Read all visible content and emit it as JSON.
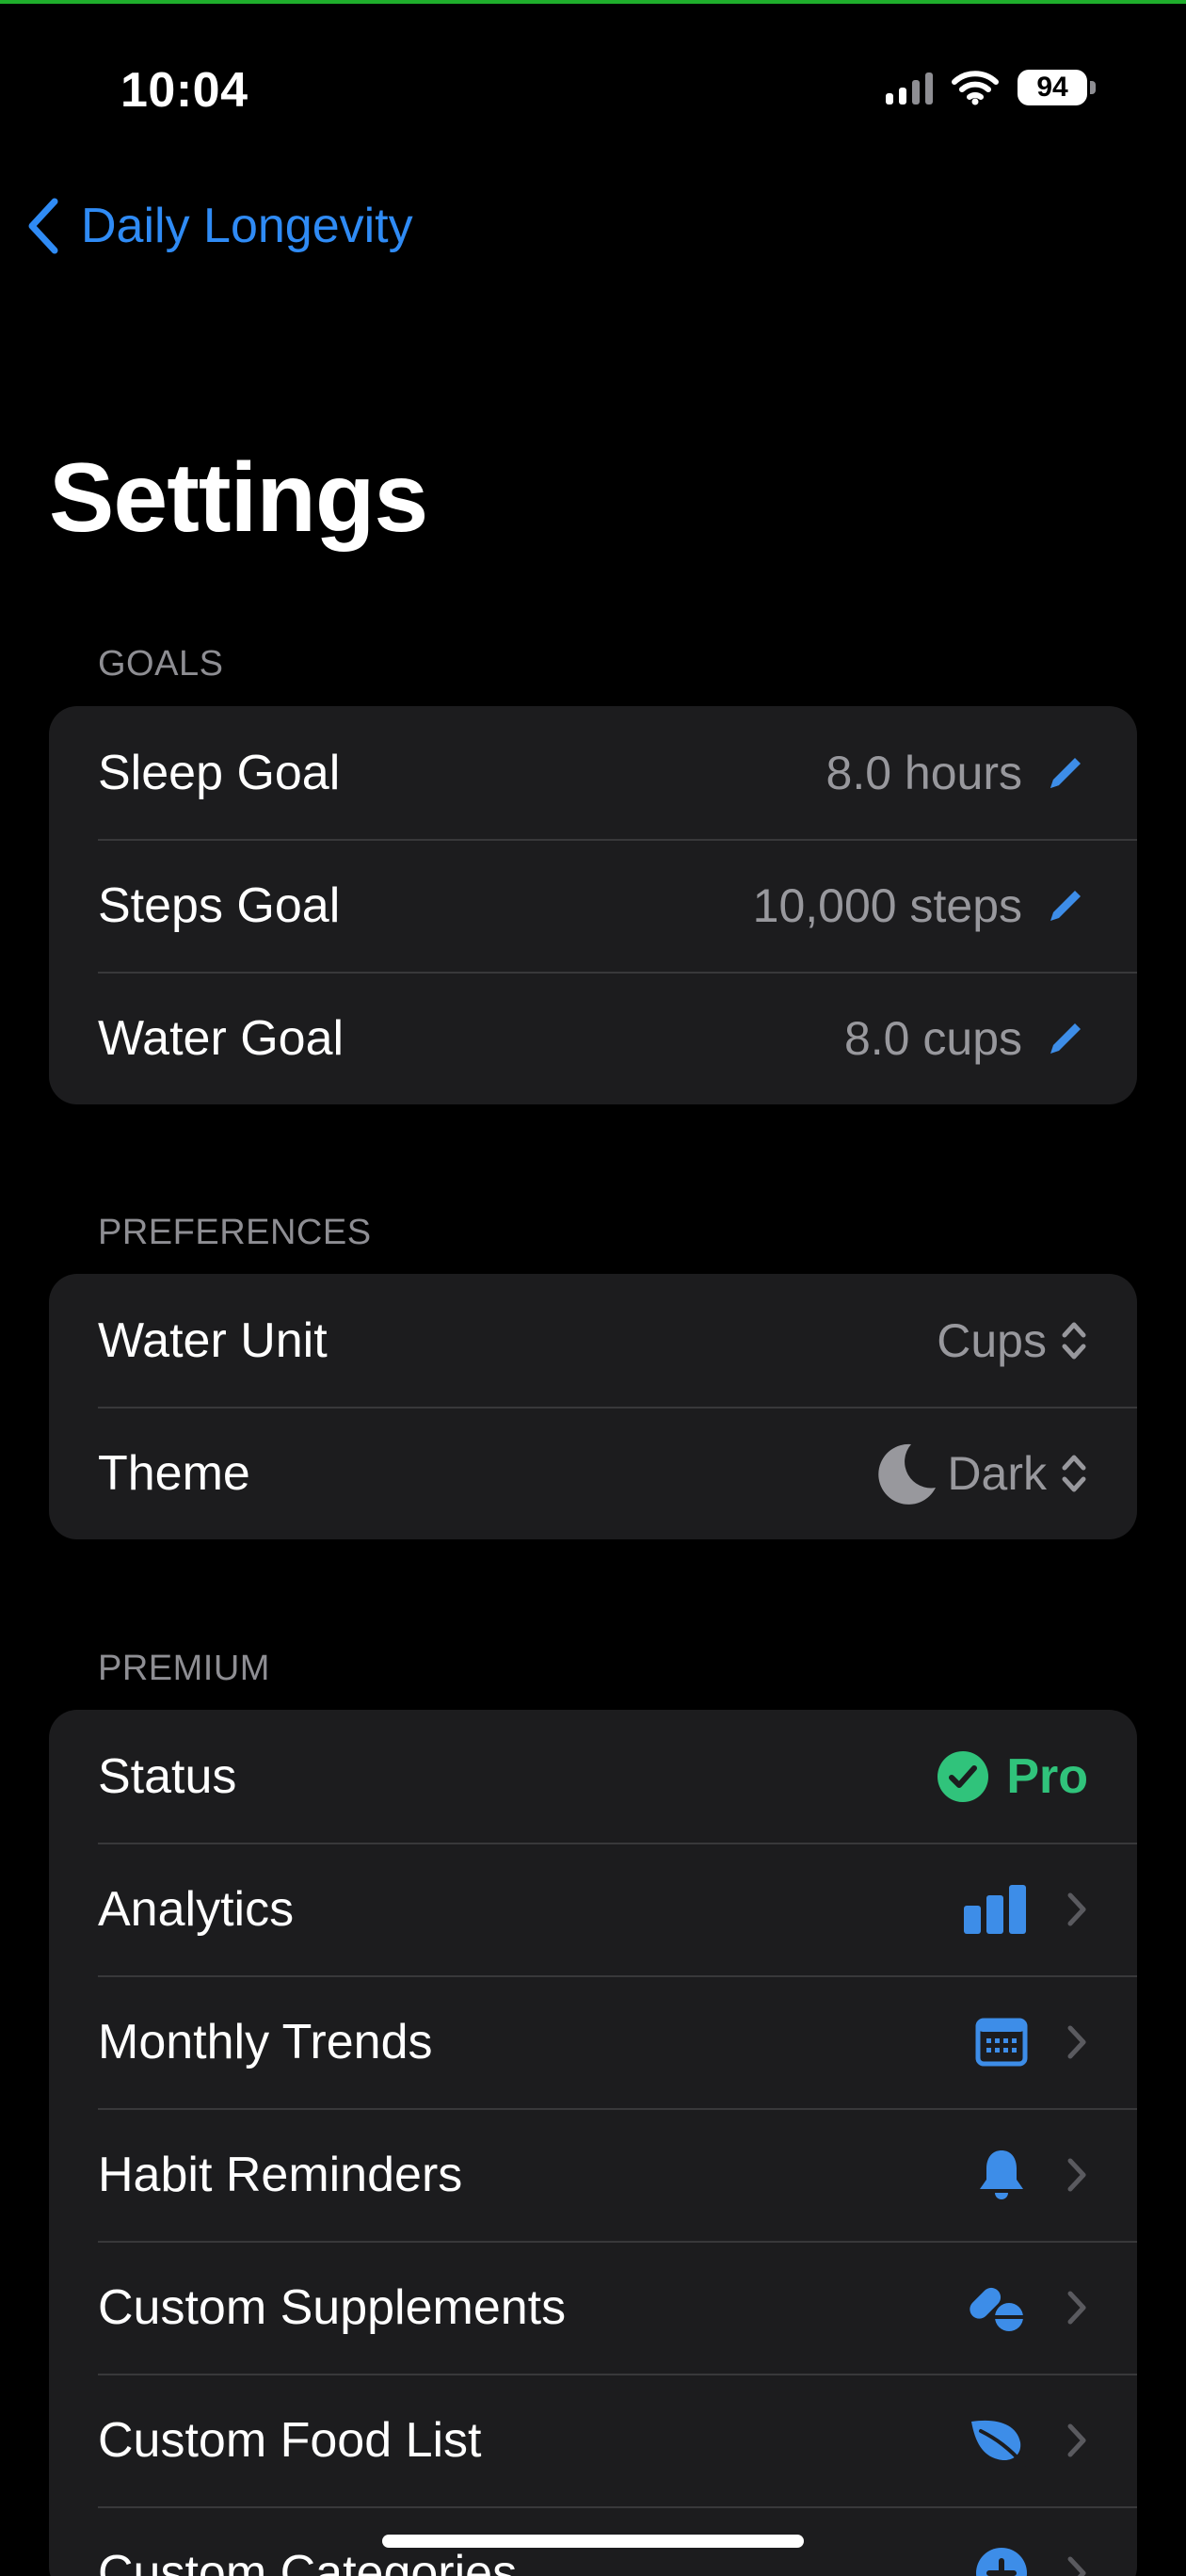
{
  "status_bar": {
    "time": "10:04",
    "battery": "94"
  },
  "nav": {
    "back_label": "Daily Longevity"
  },
  "page_title": "Settings",
  "goals": {
    "header": "GOALS",
    "rows": [
      {
        "label": "Sleep Goal",
        "value": "8.0 hours",
        "icon": "pencil-icon"
      },
      {
        "label": "Steps Goal",
        "value": "10,000 steps",
        "icon": "pencil-icon"
      },
      {
        "label": "Water Goal",
        "value": "8.0 cups",
        "icon": "pencil-icon"
      }
    ]
  },
  "preferences": {
    "header": "PREFERENCES",
    "rows": [
      {
        "label": "Water Unit",
        "value": "Cups",
        "icon": "up-down-chevron-icon"
      },
      {
        "label": "Theme",
        "value": "Dark",
        "icon": "moon-icon"
      }
    ]
  },
  "premium": {
    "header": "PREMIUM",
    "status": {
      "label": "Status",
      "value": "Pro",
      "icon": "checkmark-circle-icon"
    },
    "rows": [
      {
        "label": "Analytics",
        "icon": "bar-chart-icon"
      },
      {
        "label": "Monthly Trends",
        "icon": "calendar-icon"
      },
      {
        "label": "Habit Reminders",
        "icon": "bell-icon"
      },
      {
        "label": "Custom Supplements",
        "icon": "pills-icon"
      },
      {
        "label": "Custom Food List",
        "icon": "leaf-icon"
      },
      {
        "label": "Custom Categories",
        "icon": "plus-circle-icon"
      }
    ]
  },
  "colors": {
    "accent": "#2f8bf5",
    "pro_green": "#30c37b",
    "icon_blue": "#3d8de8",
    "background": "#000000",
    "cell": "#1c1c1e",
    "secondary_text": "#98989d"
  }
}
